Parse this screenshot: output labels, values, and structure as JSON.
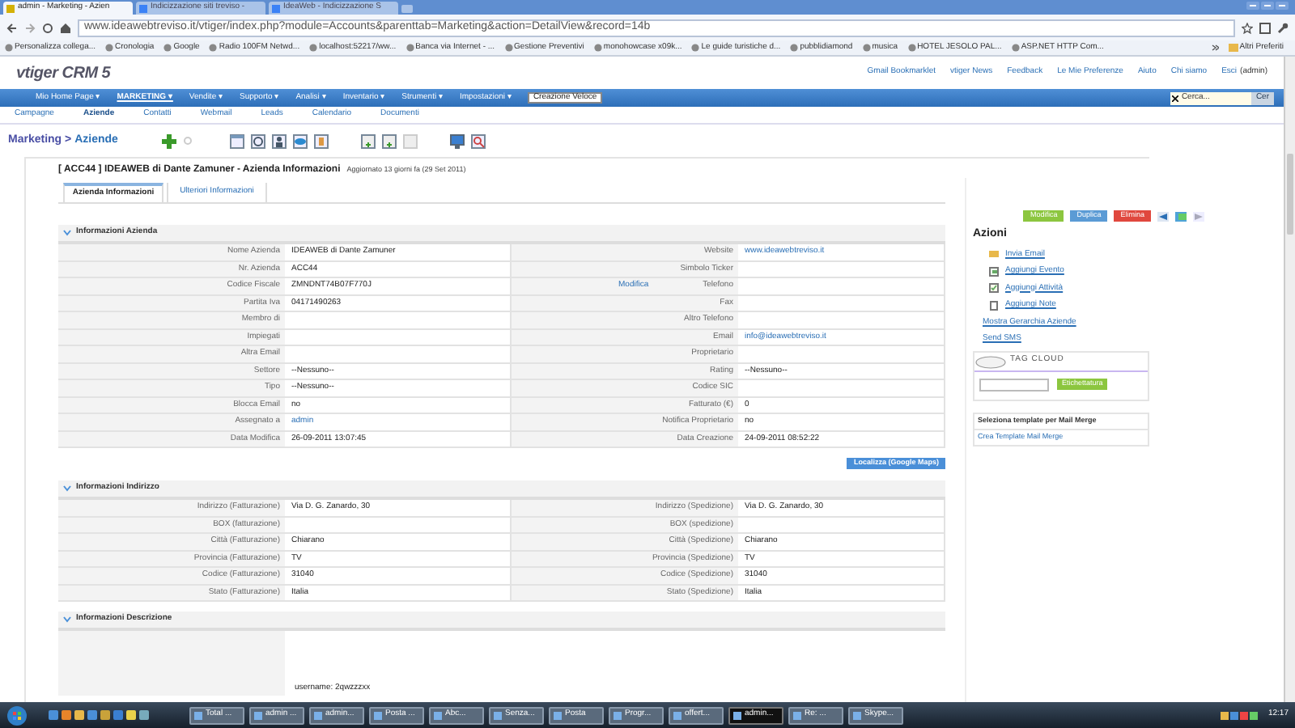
{
  "browser": {
    "tabs": [
      {
        "label": "admin - Marketing - Azien",
        "selected": true
      },
      {
        "label": "Indicizzazione siti treviso - ",
        "selected": false
      },
      {
        "label": "IdeaWeb - Indicizzazione S",
        "selected": false
      }
    ],
    "url": "www.ideawebtreviso.it/vtiger/index.php?module=Accounts&parenttab=Marketing&action=DetailView&record=14b",
    "bookmarks": [
      "Personalizza collega...",
      "Cronologia",
      "Google",
      "Radio 100FM Netwd...",
      "localhost:52217/ww...",
      "Banca via Internet - ...",
      "Gestione Preventivi",
      "monohowcase x09k...",
      "Le guide turistiche d...",
      "pubblidiamond",
      "musica",
      "HOTEL JESOLO PAL...",
      "ASP.NET HTTP Com..."
    ],
    "more_bookmarks": "Altri Preferiti"
  },
  "app": {
    "logo": "vtiger CRM 5",
    "top_links": [
      "Gmail Bookmarklet",
      "vtiger News",
      "Feedback",
      "Le Mie Preferenze",
      "Aiuto",
      "Chi siamo",
      "Esci"
    ],
    "user": "(admin)",
    "menu": [
      {
        "label": "Mio Home Page ▾",
        "selected": false
      },
      {
        "label": "MARKETING ▾",
        "selected": true
      },
      {
        "label": "Vendite ▾",
        "selected": false
      },
      {
        "label": "Supporto ▾",
        "selected": false
      },
      {
        "label": "Analisi ▾",
        "selected": false
      },
      {
        "label": "Inventario ▾",
        "selected": false
      },
      {
        "label": "Strumenti ▾",
        "selected": false
      },
      {
        "label": "Impostazioni ▾",
        "selected": false
      }
    ],
    "quick_create": "Creazione Veloce",
    "search": {
      "placeholder": "Cerca...",
      "button": "Cer"
    },
    "submenu": [
      {
        "label": "Campagne",
        "selected": false
      },
      {
        "label": "Aziende",
        "selected": true
      },
      {
        "label": "Contatti",
        "selected": false
      },
      {
        "label": "Webmail",
        "selected": false
      },
      {
        "label": "Leads",
        "selected": false
      },
      {
        "label": "Calendario",
        "selected": false
      },
      {
        "label": "Documenti",
        "selected": false
      }
    ],
    "breadcrumb": {
      "module": "Marketing >",
      "page": "Aziende"
    },
    "record": {
      "title": "[ ACC44 ] IDEAWEB di Dante Zamuner - Azienda Informazioni",
      "updated": "Aggiornato 13 giorni fa (29 Set 2011)",
      "tabs": [
        {
          "label": "Azienda Informazioni",
          "selected": true
        },
        {
          "label": "Ulteriori Informazioni",
          "selected": false
        }
      ],
      "actions": [
        {
          "label": "Modifica",
          "color": "#8cc63f"
        },
        {
          "label": "Duplica",
          "color": "#5b9bd5"
        },
        {
          "label": "Elimina",
          "color": "#e0483e"
        }
      ],
      "sections": [
        {
          "title": "Informazioni Azienda",
          "rows": [
            [
              {
                "label": "Nome Azienda",
                "value": "IDEAWEB di Dante Zamuner"
              },
              {
                "label": "Website",
                "value": "www.ideawebtreviso.it",
                "link": true
              }
            ],
            [
              {
                "label": "Nr. Azienda",
                "value": "ACC44"
              },
              {
                "label": "Simbolo Ticker"
              }
            ],
            [
              {
                "label": "Codice Fiscale",
                "value": "ZMNDNT74B07F770J"
              },
              {
                "label": "Telefono",
                "action": "Modifica"
              }
            ],
            [
              {
                "label": "Partita Iva",
                "value": "04171490263"
              },
              {
                "label": "Fax"
              }
            ],
            [
              {
                "label": "Membro di"
              },
              {
                "label": "Altro Telefono"
              }
            ],
            [
              {
                "label": "Impiegati"
              },
              {
                "label": "Email",
                "value": "info@ideawebtreviso.it",
                "link": true
              }
            ],
            [
              {
                "label": "Altra Email"
              },
              {
                "label": "Proprietario"
              }
            ],
            [
              {
                "label": "Settore",
                "value": "--Nessuno--"
              },
              {
                "label": "Rating",
                "value": "--Nessuno--"
              }
            ],
            [
              {
                "label": "Tipo",
                "value": "--Nessuno--"
              },
              {
                "label": "Codice SIC"
              }
            ],
            [
              {
                "label": "Blocca Email",
                "value": "no"
              },
              {
                "label": "Fatturato (€)",
                "value": "0"
              }
            ],
            [
              {
                "label": "Assegnato a",
                "value": "admin",
                "link": true
              },
              {
                "label": "Notifica Proprietario",
                "value": "no"
              }
            ],
            [
              {
                "label": "Data Modifica",
                "value": "26-09-2011 13:07:45"
              },
              {
                "label": "Data Creazione",
                "value": "24-09-2011 08:52:22"
              }
            ]
          ],
          "button": "Localizza (Google Maps)"
        },
        {
          "title": "Informazioni Indirizzo",
          "rows": [
            [
              {
                "label": "Indirizzo (Fatturazione)",
                "value": "Via D. G. Zanardo, 30"
              },
              {
                "label": "Indirizzo (Spedizione)",
                "value": "Via D. G. Zanardo, 30"
              }
            ],
            [
              {
                "label": "BOX (fatturazione)"
              },
              {
                "label": "BOX (spedizione)"
              }
            ],
            [
              {
                "label": "Città (Fatturazione)",
                "value": "Chiarano"
              },
              {
                "label": "Città (Spedizione)",
                "value": "Chiarano"
              }
            ],
            [
              {
                "label": "Provincia (Fatturazione)",
                "value": "TV"
              },
              {
                "label": "Provincia (Spedizione)",
                "value": "TV"
              }
            ],
            [
              {
                "label": "Codice (Fatturazione)",
                "value": "31040"
              },
              {
                "label": "Codice (Spedizione)",
                "value": "31040"
              }
            ],
            [
              {
                "label": "Stato (Fatturazione)",
                "value": "Italia"
              },
              {
                "label": "Stato (Spedizione)",
                "value": "Italia"
              }
            ]
          ]
        },
        {
          "title": "Informazioni Descrizione",
          "description": "username: 2qwzzzxx"
        }
      ]
    },
    "sidebar": {
      "title": "Azioni",
      "actions": [
        {
          "label": "Invia Email",
          "kind": "email"
        },
        {
          "label": "Aggiungi Evento",
          "kind": "event"
        },
        {
          "label": "Aggiungi Attività",
          "kind": "task"
        },
        {
          "label": "Aggiungi Note",
          "kind": "note"
        },
        {
          "label": "Mostra Gerarchia Aziende",
          "kind": "plain"
        },
        {
          "label": "Send SMS",
          "kind": "plain"
        }
      ],
      "tag_cloud": {
        "title": "TAG CLOUD",
        "button": "Etichettatura"
      },
      "mail_merge": {
        "title": "Seleziona template per Mail Merge",
        "link": "Crea Template Mail Merge"
      }
    }
  },
  "taskbar": {
    "items": [
      {
        "label": "Total ...",
        "selected": false
      },
      {
        "label": "admin ...",
        "selected": false
      },
      {
        "label": "admin...",
        "selected": false
      },
      {
        "label": "Posta ...",
        "selected": false
      },
      {
        "label": "Abc...",
        "selected": false
      },
      {
        "label": "Senza...",
        "selected": false
      },
      {
        "label": "Posta",
        "selected": false
      },
      {
        "label": "Progr...",
        "selected": false
      },
      {
        "label": "offert...",
        "selected": false
      },
      {
        "label": "admin...",
        "selected": true
      },
      {
        "label": "Re: ...",
        "selected": false
      },
      {
        "label": "Skype...",
        "selected": false
      }
    ],
    "clock": "12:17"
  }
}
